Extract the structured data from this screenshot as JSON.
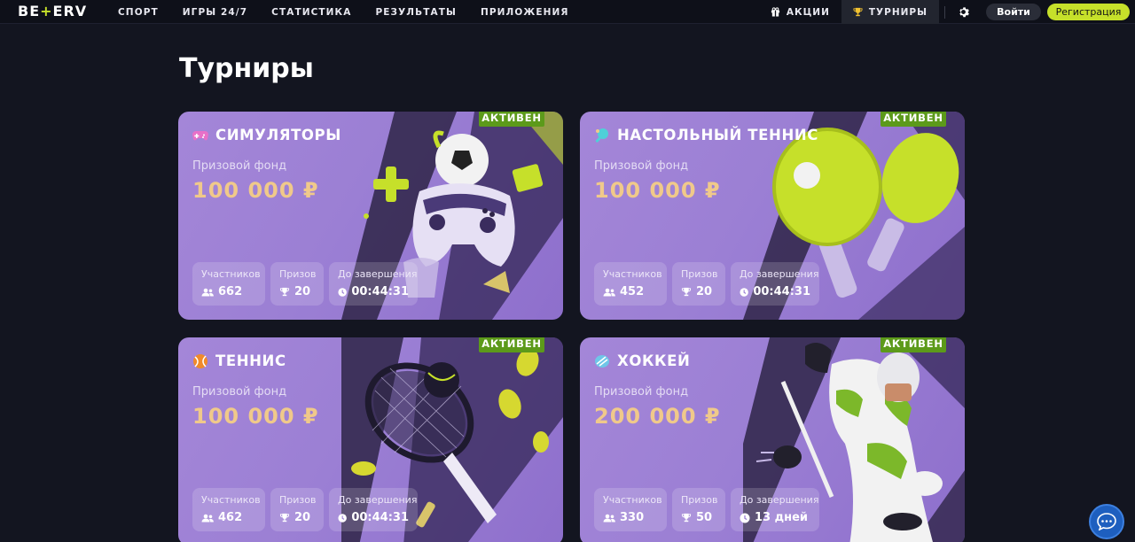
{
  "header": {
    "logo_left": "BE",
    "logo_plus": "+",
    "logo_right": "ERV",
    "nav": [
      "СПОРТ",
      "ИГРЫ 24/7",
      "СТАТИСТИКА",
      "РЕЗУЛЬТАТЫ",
      "ПРИЛОЖЕНИЯ"
    ],
    "promo": "АКЦИИ",
    "tournaments": "ТУРНИРЫ",
    "login": "Войти",
    "register": "Регистрация"
  },
  "page_title": "Турниры",
  "labels": {
    "fund": "Призовой фонд",
    "participants": "Участников",
    "prizes": "Призов",
    "ends": "До завершения",
    "status": "АКТИВЕН"
  },
  "cards": [
    {
      "title": "СИМУЛЯТОРЫ",
      "fund": "100 000 ₽",
      "participants": "662",
      "prizes": "20",
      "time": "00:44:31",
      "icon": "gamepad-icon"
    },
    {
      "title": "НАСТОЛЬНЫЙ ТЕННИС",
      "fund": "100 000 ₽",
      "participants": "452",
      "prizes": "20",
      "time": "00:44:31",
      "icon": "table-tennis-icon"
    },
    {
      "title": "ТЕННИС",
      "fund": "100 000 ₽",
      "participants": "462",
      "prizes": "20",
      "time": "00:44:31",
      "icon": "tennis-ball-icon"
    },
    {
      "title": "ХОККЕЙ",
      "fund": "200 000 ₽",
      "participants": "330",
      "prizes": "50",
      "time": "13 дней",
      "icon": "hockey-puck-icon"
    }
  ],
  "colors": {
    "accent": "#c6e02a",
    "badge": "#5c9a1a",
    "card": "#9b7fd4",
    "fund": "#f0c98a",
    "background": "#131520"
  }
}
